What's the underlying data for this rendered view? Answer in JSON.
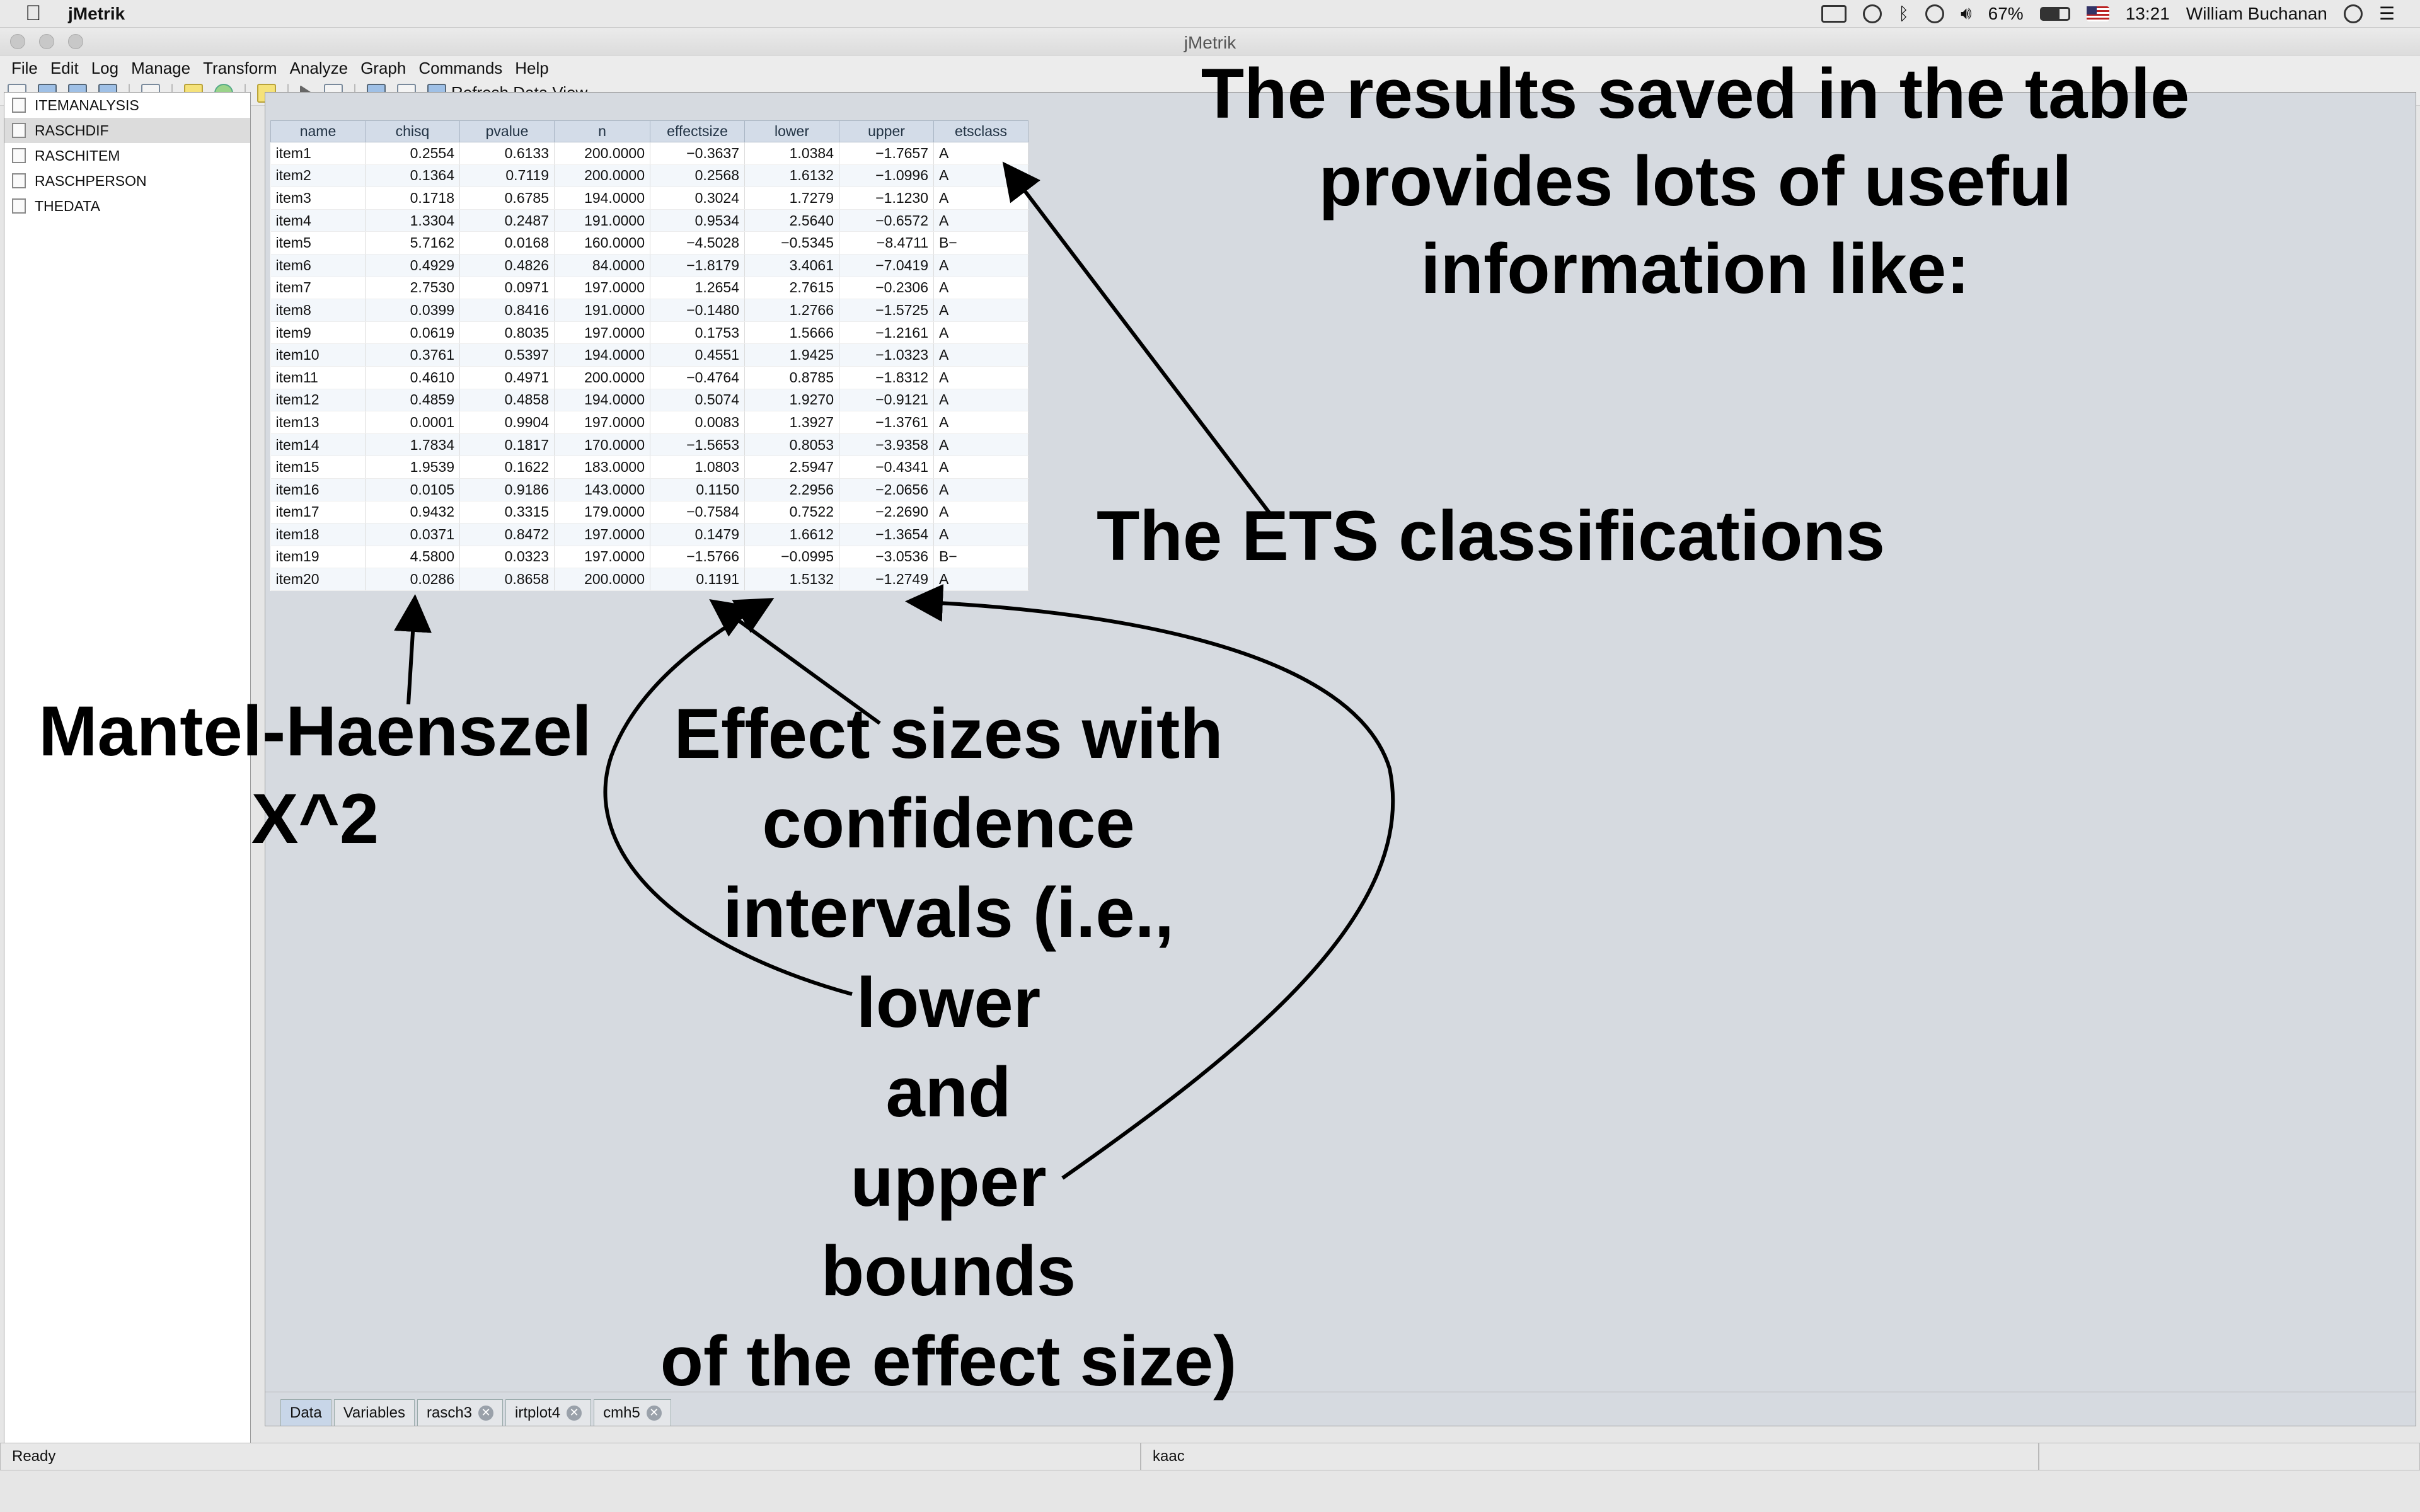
{
  "menubar": {
    "app_name": "jMetrik",
    "battery": "67%",
    "time": "13:21",
    "user": "William Buchanan"
  },
  "window": {
    "title": "jMetrik",
    "menus": [
      "File",
      "Edit",
      "Log",
      "Manage",
      "Transform",
      "Analyze",
      "Graph",
      "Commands",
      "Help"
    ],
    "refresh_label": "Refresh Data View"
  },
  "tree": {
    "items": [
      "ITEMANALYSIS",
      "RASCHDIF",
      "RASCHITEM",
      "RASCHPERSON",
      "THEDATA"
    ],
    "selected": "RASCHDIF"
  },
  "table": {
    "columns": [
      "name",
      "chisq",
      "pvalue",
      "n",
      "effectsize",
      "lower",
      "upper",
      "etsclass"
    ],
    "rows": [
      [
        "item1",
        "0.2554",
        "0.6133",
        "200.0000",
        "−0.3637",
        "1.0384",
        "−1.7657",
        "A"
      ],
      [
        "item2",
        "0.1364",
        "0.7119",
        "200.0000",
        "0.2568",
        "1.6132",
        "−1.0996",
        "A"
      ],
      [
        "item3",
        "0.1718",
        "0.6785",
        "194.0000",
        "0.3024",
        "1.7279",
        "−1.1230",
        "A"
      ],
      [
        "item4",
        "1.3304",
        "0.2487",
        "191.0000",
        "0.9534",
        "2.5640",
        "−0.6572",
        "A"
      ],
      [
        "item5",
        "5.7162",
        "0.0168",
        "160.0000",
        "−4.5028",
        "−0.5345",
        "−8.4711",
        "B−"
      ],
      [
        "item6",
        "0.4929",
        "0.4826",
        "84.0000",
        "−1.8179",
        "3.4061",
        "−7.0419",
        "A"
      ],
      [
        "item7",
        "2.7530",
        "0.0971",
        "197.0000",
        "1.2654",
        "2.7615",
        "−0.2306",
        "A"
      ],
      [
        "item8",
        "0.0399",
        "0.8416",
        "191.0000",
        "−0.1480",
        "1.2766",
        "−1.5725",
        "A"
      ],
      [
        "item9",
        "0.0619",
        "0.8035",
        "197.0000",
        "0.1753",
        "1.5666",
        "−1.2161",
        "A"
      ],
      [
        "item10",
        "0.3761",
        "0.5397",
        "194.0000",
        "0.4551",
        "1.9425",
        "−1.0323",
        "A"
      ],
      [
        "item11",
        "0.4610",
        "0.4971",
        "200.0000",
        "−0.4764",
        "0.8785",
        "−1.8312",
        "A"
      ],
      [
        "item12",
        "0.4859",
        "0.4858",
        "194.0000",
        "0.5074",
        "1.9270",
        "−0.9121",
        "A"
      ],
      [
        "item13",
        "0.0001",
        "0.9904",
        "197.0000",
        "0.0083",
        "1.3927",
        "−1.3761",
        "A"
      ],
      [
        "item14",
        "1.7834",
        "0.1817",
        "170.0000",
        "−1.5653",
        "0.8053",
        "−3.9358",
        "A"
      ],
      [
        "item15",
        "1.9539",
        "0.1622",
        "183.0000",
        "1.0803",
        "2.5947",
        "−0.4341",
        "A"
      ],
      [
        "item16",
        "0.0105",
        "0.9186",
        "143.0000",
        "0.1150",
        "2.2956",
        "−2.0656",
        "A"
      ],
      [
        "item17",
        "0.9432",
        "0.3315",
        "179.0000",
        "−0.7584",
        "0.7522",
        "−2.2690",
        "A"
      ],
      [
        "item18",
        "0.0371",
        "0.8472",
        "197.0000",
        "0.1479",
        "1.6612",
        "−1.3654",
        "A"
      ],
      [
        "item19",
        "4.5800",
        "0.0323",
        "197.0000",
        "−1.5766",
        "−0.0995",
        "−3.0536",
        "B−"
      ],
      [
        "item20",
        "0.0286",
        "0.8658",
        "200.0000",
        "0.1191",
        "1.5132",
        "−1.2749",
        "A"
      ]
    ]
  },
  "tabs": [
    {
      "label": "Data",
      "closable": false,
      "active": true
    },
    {
      "label": "Variables",
      "closable": false,
      "active": false
    },
    {
      "label": "rasch3",
      "closable": true,
      "active": false
    },
    {
      "label": "irtplot4",
      "closable": true,
      "active": false
    },
    {
      "label": "cmh5",
      "closable": true,
      "active": false
    }
  ],
  "status": {
    "left": "Ready",
    "middle": "kaac",
    "right": ""
  },
  "annotations": {
    "results": [
      "The results saved in the table",
      "provides lots of useful",
      "information like:"
    ],
    "ets": "The ETS classifications",
    "mh": [
      "Mantel-Haenszel",
      "X^2"
    ],
    "effect": [
      "Effect sizes with",
      "confidence",
      "intervals (i.e.,",
      "lower",
      "and",
      "upper",
      "bounds",
      "of the effect size)"
    ]
  }
}
